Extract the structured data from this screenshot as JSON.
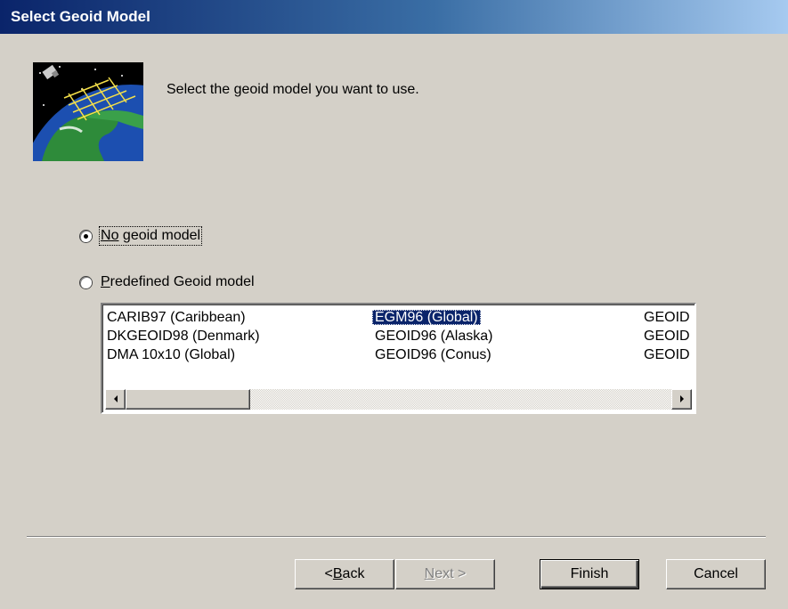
{
  "window": {
    "title": "Select Geoid Model"
  },
  "header": {
    "instruction": "Select the geoid model you want to use.",
    "logo_icon": "satellite-earth-icon"
  },
  "options": {
    "no_model": {
      "label_mnemonic": "N",
      "label_u": "o",
      "label_rest": " geoid model",
      "selected": true
    },
    "predefined": {
      "label_mnemonic": "P",
      "label_rest": "redefined Geoid model",
      "selected": false
    }
  },
  "geoid_list": {
    "columns": [
      [
        "CARIB97 (Caribbean)",
        "DKGEOID98 (Denmark)",
        "DMA 10x10 (Global)"
      ],
      [
        "EGM96 (Global)",
        "GEOID96 (Alaska)",
        "GEOID96 (Conus)"
      ],
      [
        "GEOID",
        "GEOID",
        "GEOID"
      ]
    ],
    "selected_item": "EGM96 (Global)"
  },
  "buttons": {
    "back_pre": "< ",
    "back_mnemonic": "B",
    "back_rest": "ack",
    "next_mnemonic": "N",
    "next_rest": "ext >",
    "finish": "Finish",
    "cancel": "Cancel"
  },
  "colors": {
    "title_bar": "#0a246a",
    "selection": "#0a246a",
    "dialog_bg": "#d4d0c8"
  }
}
